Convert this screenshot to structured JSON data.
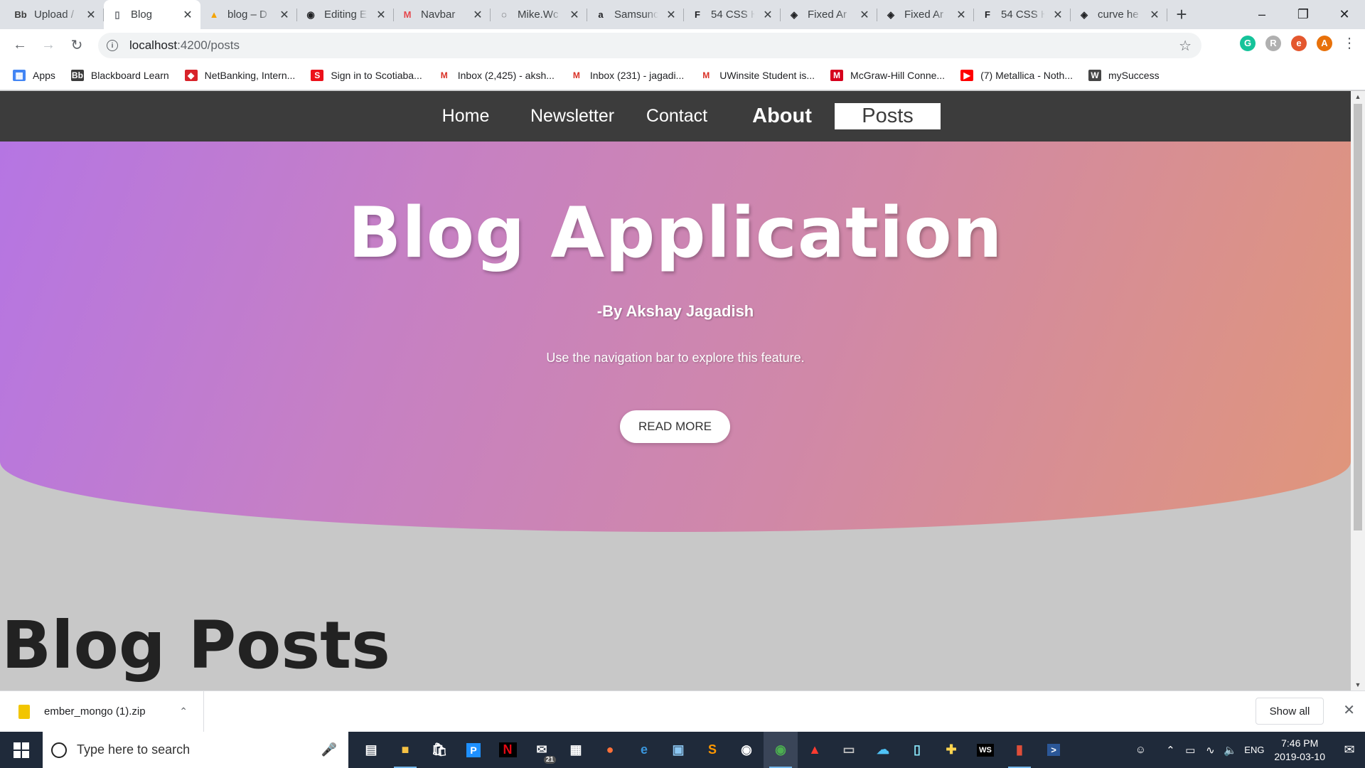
{
  "browser": {
    "tabs": [
      {
        "title": "Upload / ",
        "icon": "blackboard-icon",
        "icon_text": "Bb",
        "icon_color": "#3c3c3c",
        "active": false
      },
      {
        "title": "Blog",
        "icon": "page-icon",
        "icon_text": "▯",
        "icon_color": "#5f6368",
        "active": true
      },
      {
        "title": "blog – D",
        "icon": "firebase-icon",
        "icon_text": "▲",
        "icon_color": "#f4a300",
        "active": false
      },
      {
        "title": "Editing E",
        "icon": "github-icon",
        "icon_text": "◉",
        "icon_color": "#202124",
        "active": false
      },
      {
        "title": "Navbar",
        "icon": "navbar-icon",
        "icon_text": "M",
        "icon_color": "#e5484d",
        "active": false
      },
      {
        "title": "Mike.Wc",
        "icon": "mike-icon",
        "icon_text": "◌",
        "icon_color": "#202124",
        "active": false
      },
      {
        "title": "Samsunc",
        "icon": "amazon-icon",
        "icon_text": "a",
        "icon_color": "#202124",
        "active": false
      },
      {
        "title": "54 CSS H",
        "icon": "f-icon",
        "icon_text": "F",
        "icon_color": "#202124",
        "active": false
      },
      {
        "title": "Fixed Ar",
        "icon": "codepen-icon",
        "icon_text": "◈",
        "icon_color": "#202124",
        "active": false
      },
      {
        "title": "Fixed Ar",
        "icon": "codepen-icon",
        "icon_text": "◈",
        "icon_color": "#202124",
        "active": false
      },
      {
        "title": "54 CSS H",
        "icon": "f-icon",
        "icon_text": "F",
        "icon_color": "#202124",
        "active": false
      },
      {
        "title": "curve he",
        "icon": "codepen-icon",
        "icon_text": "◈",
        "icon_color": "#202124",
        "active": false
      }
    ],
    "url_host": "localhost",
    "url_path": ":4200/posts",
    "bookmarks": [
      {
        "label": "Apps",
        "icon": "apps-grid-icon",
        "color": "#4285f4",
        "glyph": "▦"
      },
      {
        "label": "Blackboard Learn",
        "icon": "blackboard-icon",
        "color": "#3c3c3c",
        "glyph": "Bb"
      },
      {
        "label": "NetBanking, Intern...",
        "icon": "bank-icon",
        "color": "#d8232a",
        "glyph": "◆"
      },
      {
        "label": "Sign in to Scotiaba...",
        "icon": "scotiabank-icon",
        "color": "#ec111a",
        "glyph": "S"
      },
      {
        "label": "Inbox (2,425) - aksh...",
        "icon": "gmail-icon",
        "color": "#ffffff",
        "glyph": "M"
      },
      {
        "label": "Inbox (231) - jagadi...",
        "icon": "gmail-icon",
        "color": "#ffffff",
        "glyph": "M"
      },
      {
        "label": "UWinsite Student is...",
        "icon": "gmail-icon",
        "color": "#ffffff",
        "glyph": "M"
      },
      {
        "label": "McGraw-Hill Conne...",
        "icon": "mcgraw-icon",
        "color": "#d6001c",
        "glyph": "M"
      },
      {
        "label": "(7) Metallica - Noth...",
        "icon": "youtube-icon",
        "color": "#ff0000",
        "glyph": "▶"
      },
      {
        "label": "mySuccess",
        "icon": "wordpress-icon",
        "color": "#464646",
        "glyph": "W"
      }
    ],
    "extensions": [
      {
        "name": "grammarly-icon",
        "glyph": "G",
        "color": "#15c39a"
      },
      {
        "name": "r-extension-icon",
        "glyph": "R",
        "color": "#b0b0b0"
      },
      {
        "name": "e-extension-icon",
        "glyph": "e",
        "color": "#e4572e"
      },
      {
        "name": "profile-avatar-icon",
        "glyph": "A",
        "color": "#e8710a"
      }
    ]
  },
  "site": {
    "nav": [
      "Home",
      "Newsletter",
      "Contact",
      "About",
      "Posts"
    ],
    "hero_title": "Blog Application",
    "hero_author": "-By Akshay Jagadish",
    "hero_desc": "Use the navigation bar to explore this feature.",
    "cta": "READ MORE",
    "section_title": "Blog Posts",
    "colors": {
      "nav_bg": "#3c3c3c",
      "gradient_start": "#b575e3",
      "gradient_end": "#e0967a",
      "page_bg": "#c8c8c8"
    }
  },
  "downloads": {
    "file": "ember_mongo (1).zip",
    "show_all": "Show all"
  },
  "taskbar": {
    "search_placeholder": "Type here to search",
    "mail_badge": "21",
    "language": "ENG",
    "time": "7:46 PM",
    "date": "2019-03-10"
  }
}
